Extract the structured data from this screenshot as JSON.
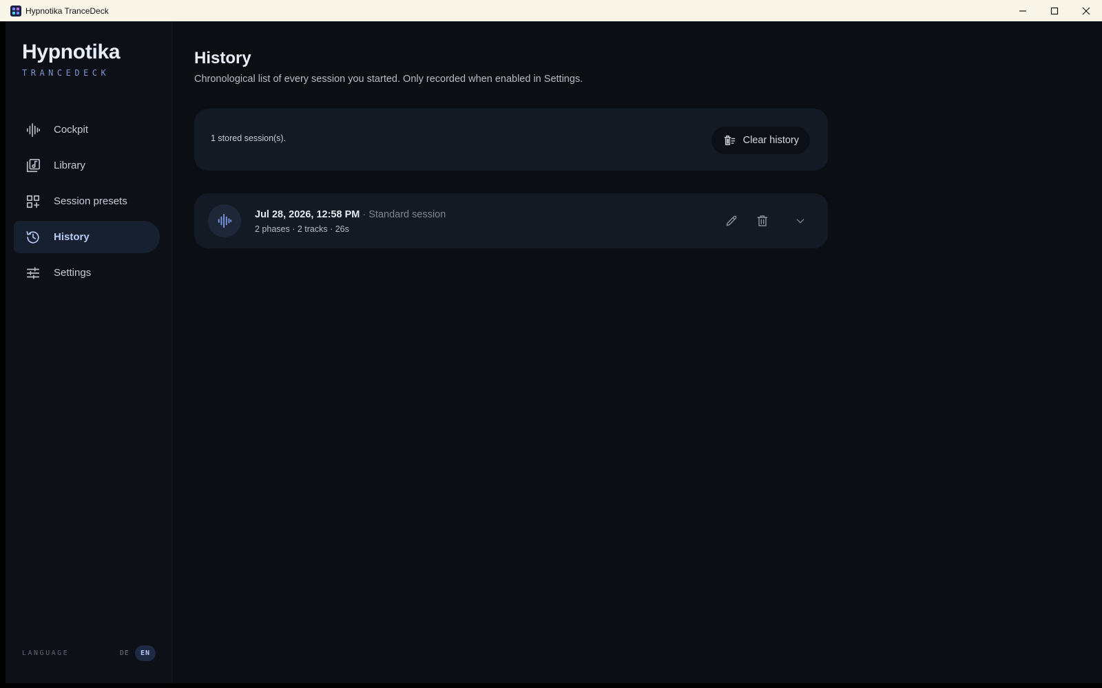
{
  "window": {
    "title": "Hypnotika TranceDeck"
  },
  "brand": {
    "name": "Hypnotika",
    "subtitle": "TRANCEDECK"
  },
  "sidebar": {
    "items": [
      {
        "label": "Cockpit",
        "icon": "waveform-icon",
        "active": false
      },
      {
        "label": "Library",
        "icon": "music-library-icon",
        "active": false
      },
      {
        "label": "Session presets",
        "icon": "grid-add-icon",
        "active": false
      },
      {
        "label": "History",
        "icon": "history-icon",
        "active": true
      },
      {
        "label": "Settings",
        "icon": "sliders-icon",
        "active": false
      }
    ],
    "language": {
      "label": "LANGUAGE",
      "options": [
        "DE",
        "EN"
      ],
      "selected": "EN"
    }
  },
  "page": {
    "title": "History",
    "subtitle": "Chronological list of every session you started. Only recorded when enabled in Settings."
  },
  "summary": {
    "count_text": "1 stored session(s).",
    "clear_label": "Clear history"
  },
  "sessions": [
    {
      "date": "Jul 28, 2026, 12:58 PM",
      "separator": "·",
      "type": "Standard session",
      "details": "2 phases · 2 tracks · 26s"
    }
  ],
  "colors": {
    "accent": "#7c9ae8",
    "background": "#0b0e13",
    "card": "#141a23",
    "active_nav": "#17202f"
  }
}
